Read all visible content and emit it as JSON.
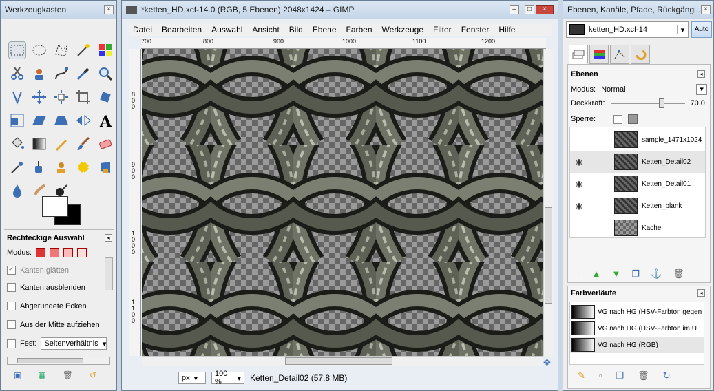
{
  "toolbox": {
    "title": "Werkzeugkasten",
    "options_title": "Rechteckige Auswahl",
    "mode_label": "Modus:",
    "opt_smooth": "Kanten glätten",
    "opt_feather": "Kanten ausblenden",
    "opt_rounded": "Abgerundete Ecken",
    "opt_center": "Aus der Mitte aufziehen",
    "opt_fixed": "Fest:",
    "fixed_value": "Seitenverhältnis"
  },
  "image_window": {
    "title": "*ketten_HD.xcf-14.0 (RGB, 5 Ebenen) 2048x1424 – GIMP",
    "menus": [
      "Datei",
      "Bearbeiten",
      "Auswahl",
      "Ansicht",
      "Bild",
      "Ebene",
      "Farben",
      "Werkzeuge",
      "Filter",
      "Fenster",
      "Hilfe"
    ],
    "ruler_h": [
      "700",
      "800",
      "900",
      "1000",
      "1100",
      "1200"
    ],
    "ruler_v": [
      "800",
      "900",
      "1000",
      "1100"
    ],
    "unit": "px",
    "zoom": "100 %",
    "status": "Ketten_Detail02 (57.8 MB)"
  },
  "dock": {
    "title": "Ebenen, Kanäle, Pfade, Rückgängi...",
    "image_combo": "ketten_HD.xcf-14",
    "auto_label": "Auto",
    "layers_title": "Ebenen",
    "mode_label": "Modus:",
    "mode_value": "Normal",
    "opacity_label": "Deckkraft:",
    "opacity_value": "70.0",
    "lock_label": "Sperre:",
    "layers": [
      {
        "name": "sample_1471x1024",
        "visible": false
      },
      {
        "name": "Ketten_Detail02",
        "visible": true
      },
      {
        "name": "Ketten_Detail01",
        "visible": true
      },
      {
        "name": "Ketten_blank",
        "visible": true
      },
      {
        "name": "Kachel",
        "visible": false
      }
    ],
    "gradients_title": "Farbverläufe",
    "gradients": [
      "VG nach HG (HSV-Farbton gegen",
      "VG nach HG (HSV-Farbton im U",
      "VG nach HG (RGB)"
    ]
  },
  "colors": {
    "link_accent": "#3d6fb4",
    "canvas_dark": "#1b1c18",
    "chain_metal": "#6f7366"
  }
}
